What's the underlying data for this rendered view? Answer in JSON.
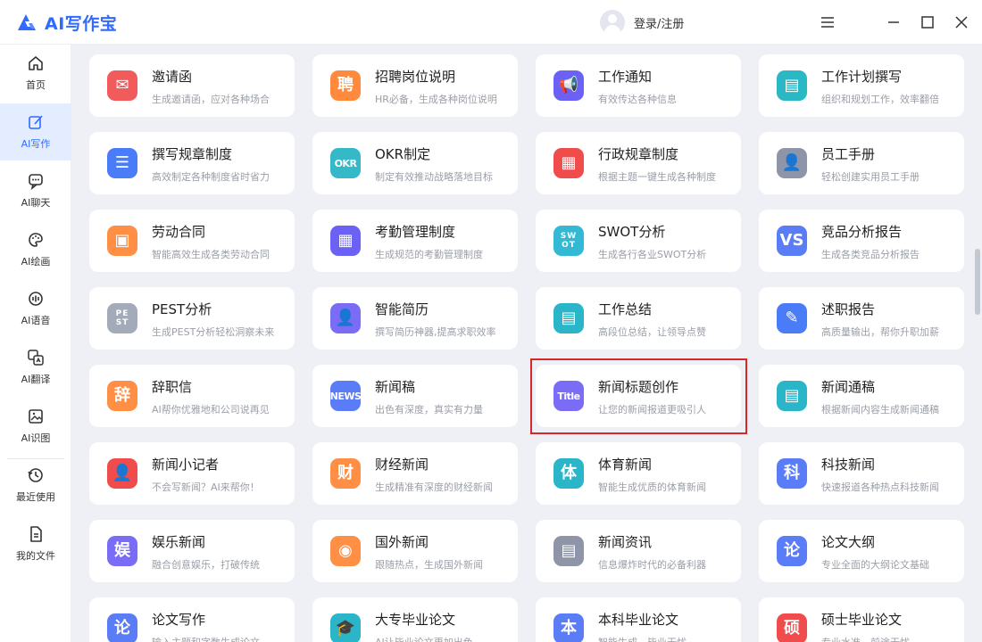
{
  "app": {
    "title": "AI写作宝"
  },
  "colors": {
    "brand": "#2f6bff",
    "active_bg": "#e4edff",
    "highlight": "#d62828"
  },
  "header": {
    "login_label": "登录/注册"
  },
  "sidebar": {
    "items": [
      {
        "label": "首页",
        "icon": "home-icon"
      },
      {
        "label": "AI写作",
        "icon": "edit-icon",
        "active": true
      },
      {
        "label": "AI聊天",
        "icon": "chat-icon"
      },
      {
        "label": "AI绘画",
        "icon": "palette-icon"
      },
      {
        "label": "AI语音",
        "icon": "voice-icon"
      },
      {
        "label": "AI翻译",
        "icon": "translate-icon"
      },
      {
        "label": "AI识图",
        "icon": "image-icon"
      },
      {
        "label": "最近使用",
        "icon": "history-icon"
      },
      {
        "label": "我的文件",
        "icon": "file-icon"
      }
    ]
  },
  "cards": [
    {
      "title": "邀请函",
      "desc": "生成邀请函，应对各种场合",
      "icon": "envelope-icon",
      "color": "#f25b5b",
      "glyph": "✉"
    },
    {
      "title": "招聘岗位说明",
      "desc": "HR必备，生成各种岗位说明",
      "icon": "recruit-icon",
      "color": "#ff8a3d",
      "glyph": "聘"
    },
    {
      "title": "工作通知",
      "desc": "有效传达各种信息",
      "icon": "megaphone-icon",
      "color": "#6b62f5",
      "glyph": "📢"
    },
    {
      "title": "工作计划撰写",
      "desc": "组织和规划工作，效率翻倍",
      "icon": "plan-icon",
      "color": "#2ab8c4",
      "glyph": "▤"
    },
    {
      "title": "撰写规章制度",
      "desc": "高效制定各种制度省时省力",
      "icon": "rules-icon",
      "color": "#4a7cf7",
      "glyph": "☰"
    },
    {
      "title": "OKR制定",
      "desc": "制定有效推动战略落地目标",
      "icon": "okr-icon",
      "color": "#35b9c9",
      "glyph": "OKR"
    },
    {
      "title": "行政规章制度",
      "desc": "根据主题一键生成各种制度",
      "icon": "admin-rules-icon",
      "color": "#f04c4c",
      "glyph": "▦"
    },
    {
      "title": "员工手册",
      "desc": "轻松创建实用员工手册",
      "icon": "handbook-icon",
      "color": "#8e95a8",
      "glyph": "👤"
    },
    {
      "title": "劳动合同",
      "desc": "智能高效生成各类劳动合同",
      "icon": "contract-icon",
      "color": "#ff8f45",
      "glyph": "▣"
    },
    {
      "title": "考勤管理制度",
      "desc": "生成规范的考勤管理制度",
      "icon": "attendance-icon",
      "color": "#6b62f5",
      "glyph": "▦"
    },
    {
      "title": "SWOT分析",
      "desc": "生成各行各业SWOT分析",
      "icon": "swot-icon",
      "color": "#33b9d4",
      "glyph": "SW\nOT"
    },
    {
      "title": "竞品分析报告",
      "desc": "生成各类竞品分析报告",
      "icon": "vs-icon",
      "color": "#5a7cf7",
      "glyph": "VS"
    },
    {
      "title": "PEST分析",
      "desc": "生成PEST分析轻松洞察未来",
      "icon": "pest-icon",
      "color": "#a3aab9",
      "glyph": "PE\nST"
    },
    {
      "title": "智能简历",
      "desc": "撰写简历神器,提高求职效率",
      "icon": "resume-icon",
      "color": "#7a6cf5",
      "glyph": "👤"
    },
    {
      "title": "工作总结",
      "desc": "高段位总结，让领导点赞",
      "icon": "summary-icon",
      "color": "#2bb5c9",
      "glyph": "▤"
    },
    {
      "title": "述职报告",
      "desc": "高质量输出，帮你升职加薪",
      "icon": "report-icon",
      "color": "#4a7cf7",
      "glyph": "✎"
    },
    {
      "title": "辞职信",
      "desc": "AI帮你优雅地和公司说再见",
      "icon": "resign-icon",
      "color": "#ff8f45",
      "glyph": "辞"
    },
    {
      "title": "新闻稿",
      "desc": "出色有深度，真实有力量",
      "icon": "news-icon",
      "color": "#5a7cf7",
      "glyph": "NEWS"
    },
    {
      "title": "新闻标题创作",
      "desc": "让您的新闻报道更吸引人",
      "icon": "headline-icon",
      "color": "#7a6cf5",
      "glyph": "Title"
    },
    {
      "title": "新闻通稿",
      "desc": "根据新闻内容生成新闻通稿",
      "icon": "press-release-icon",
      "color": "#2bb5c9",
      "glyph": "▤"
    },
    {
      "title": "新闻小记者",
      "desc": "不会写新闻？AI来帮你！",
      "icon": "reporter-icon",
      "color": "#f04c4c",
      "glyph": "👤"
    },
    {
      "title": "财经新闻",
      "desc": "生成精准有深度的财经新闻",
      "icon": "finance-icon",
      "color": "#ff8f45",
      "glyph": "财"
    },
    {
      "title": "体育新闻",
      "desc": "智能生成优质的体育新闻",
      "icon": "sports-icon",
      "color": "#2bb5c9",
      "glyph": "体"
    },
    {
      "title": "科技新闻",
      "desc": "快速报道各种热点科技新闻",
      "icon": "tech-icon",
      "color": "#5a7cf7",
      "glyph": "科"
    },
    {
      "title": "娱乐新闻",
      "desc": "融合创意娱乐，打破传统",
      "icon": "entertainment-icon",
      "color": "#7a6cf5",
      "glyph": "娱"
    },
    {
      "title": "国外新闻",
      "desc": "跟随热点，生成国外新闻",
      "icon": "globe-icon",
      "color": "#ff8f45",
      "glyph": "◉"
    },
    {
      "title": "新闻资讯",
      "desc": "信息爆炸时代的必备利器",
      "icon": "info-icon",
      "color": "#8e95a8",
      "glyph": "▤"
    },
    {
      "title": "论文大纲",
      "desc": "专业全面的大纲论文基础",
      "icon": "outline-icon",
      "color": "#5a7cf7",
      "glyph": "论"
    },
    {
      "title": "论文写作",
      "desc": "输入主题和字数生成论文",
      "icon": "paper-icon",
      "color": "#5a7cf7",
      "glyph": "论"
    },
    {
      "title": "大专毕业论文",
      "desc": "AI让毕业论文更加出色",
      "icon": "graduation-icon",
      "color": "#2bb5c9",
      "glyph": "🎓"
    },
    {
      "title": "本科毕业论文",
      "desc": "智能生成，毕业无忧",
      "icon": "bachelor-icon",
      "color": "#5a7cf7",
      "glyph": "本"
    },
    {
      "title": "硕士毕业论文",
      "desc": "专业水准，前途无忧",
      "icon": "master-icon",
      "color": "#f04c4c",
      "glyph": "硕"
    }
  ]
}
